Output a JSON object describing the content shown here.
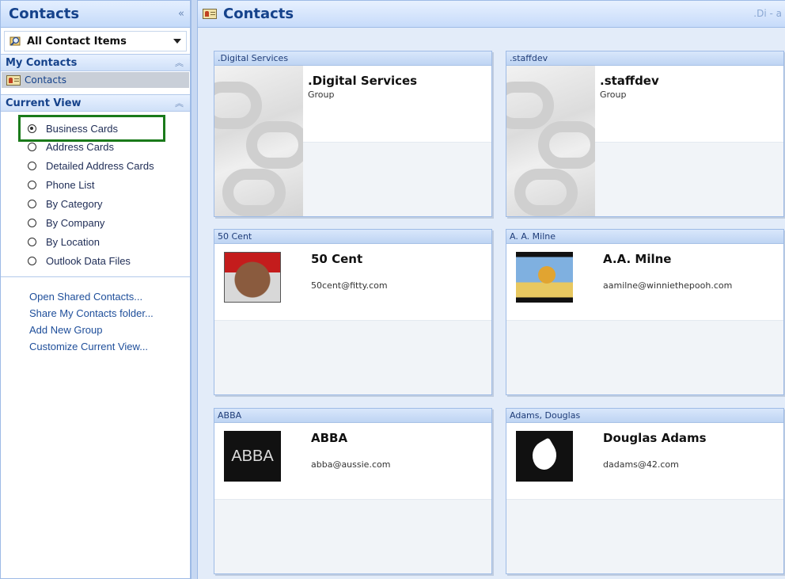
{
  "nav": {
    "title": "Contacts",
    "collapse_glyph": "«",
    "folder_dropdown": {
      "label": "All Contact Items",
      "icon": "search-folder-icon"
    },
    "my_contacts": {
      "title": "My Contacts",
      "items": [
        {
          "label": "Contacts",
          "icon": "contact-card-icon",
          "selected": true
        }
      ]
    },
    "current_view": {
      "title": "Current View",
      "options": [
        {
          "label": "Business Cards",
          "selected": true
        },
        {
          "label": "Address Cards",
          "selected": false
        },
        {
          "label": "Detailed Address Cards",
          "selected": false
        },
        {
          "label": "Phone List",
          "selected": false
        },
        {
          "label": "By Category",
          "selected": false
        },
        {
          "label": "By Company",
          "selected": false
        },
        {
          "label": "By Location",
          "selected": false
        },
        {
          "label": "Outlook Data Files",
          "selected": false
        }
      ]
    },
    "links": [
      "Open Shared Contacts...",
      "Share My Contacts folder...",
      "Add New Group",
      "Customize Current View..."
    ]
  },
  "main": {
    "title": "Contacts",
    "range_text": ".Di - a",
    "cards": [
      {
        "header": ".Digital Services",
        "name": ".Digital Services",
        "line2": "Group",
        "image": "group-chain-icon"
      },
      {
        "header": ".staffdev",
        "name": ".staffdev",
        "line2": "Group",
        "image": "group-chain-icon"
      },
      {
        "header": "50 Cent",
        "name": "50 Cent",
        "line2": "50cent@fitty.com",
        "image": "portrait-photo"
      },
      {
        "header": "A. A. Milne",
        "name": "A.A. Milne",
        "line2": "aamilne@winniethepooh.com",
        "image": "pooh-photo"
      },
      {
        "header": "ABBA",
        "name": "ABBA",
        "line2": "abba@aussie.com",
        "image": "abba-logo",
        "image_text": "ABBA"
      },
      {
        "header": "Adams, Douglas",
        "name": "Douglas Adams",
        "line2": "dadams@42.com",
        "image": "dolphin-icon"
      }
    ]
  }
}
